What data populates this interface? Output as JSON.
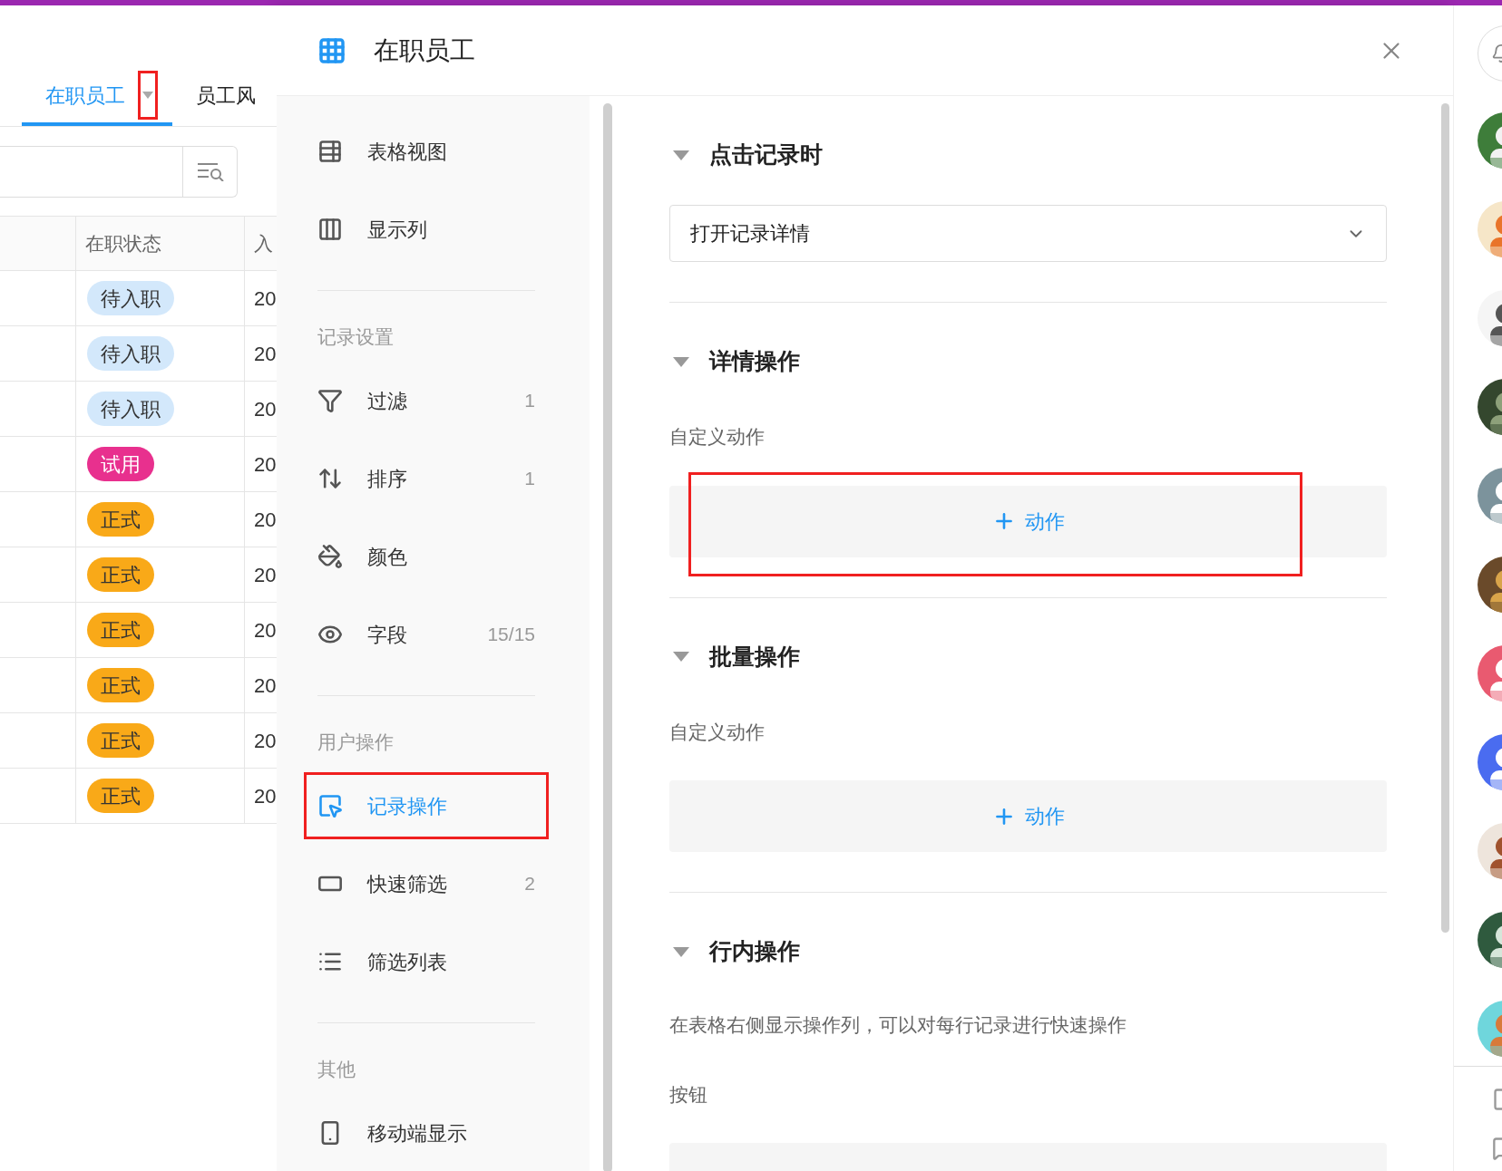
{
  "page": {
    "tabs": [
      {
        "label": "在职员工",
        "selected": true
      },
      {
        "label": "员工风",
        "selected": false
      }
    ],
    "table": {
      "columns": [
        "在职状态",
        "入"
      ],
      "rows": [
        {
          "status": "待入职",
          "color": "#d3e8fb",
          "date": "20"
        },
        {
          "status": "待入职",
          "color": "#d3e8fb",
          "date": "20"
        },
        {
          "status": "待入职",
          "color": "#d3e8fb",
          "date": "20"
        },
        {
          "status": "试用",
          "color": "#e8308e",
          "date": "20"
        },
        {
          "status": "正式",
          "color": "#f9a918",
          "date": "20"
        },
        {
          "status": "正式",
          "color": "#f9a918",
          "date": "20"
        },
        {
          "status": "正式",
          "color": "#f9a918",
          "date": "20"
        },
        {
          "status": "正式",
          "color": "#f9a918",
          "date": "20"
        },
        {
          "status": "正式",
          "color": "#f9a918",
          "date": "20"
        },
        {
          "status": "正式",
          "color": "#f9a918",
          "date": "20"
        }
      ]
    }
  },
  "panel": {
    "title": "在职员工",
    "nav": [
      {
        "items": [
          {
            "label": "表格视图",
            "selected": false
          },
          {
            "label": "显示列",
            "selected": false
          }
        ]
      },
      {
        "heading": "记录设置",
        "items": [
          {
            "label": "过滤",
            "count": "1",
            "selected": false
          },
          {
            "label": "排序",
            "count": "1",
            "selected": false
          },
          {
            "label": "颜色",
            "selected": false
          },
          {
            "label": "字段",
            "count": "15/15",
            "selected": false
          }
        ]
      },
      {
        "heading": "用户操作",
        "items": [
          {
            "label": "记录操作",
            "selected": true
          },
          {
            "label": "快速筛选",
            "count": "2",
            "selected": false
          },
          {
            "label": "筛选列表",
            "selected": false
          }
        ]
      },
      {
        "heading": "其他",
        "items": [
          {
            "label": "移动端显示",
            "selected": false
          }
        ]
      }
    ],
    "sections": [
      {
        "title": "点击记录时",
        "expanded": true,
        "kind": "select",
        "value": "打开记录详情"
      },
      {
        "title": "详情操作",
        "expanded": true,
        "kind": "actions",
        "label": "自定义动作",
        "button": "动作"
      },
      {
        "title": "批量操作",
        "expanded": true,
        "kind": "actions",
        "label": "自定义动作",
        "button": "动作"
      },
      {
        "title": "行内操作",
        "expanded": true,
        "kind": "actions",
        "description": "在表格右侧显示操作列，可以对每行记录进行快速操作",
        "label": "按钮"
      }
    ]
  }
}
